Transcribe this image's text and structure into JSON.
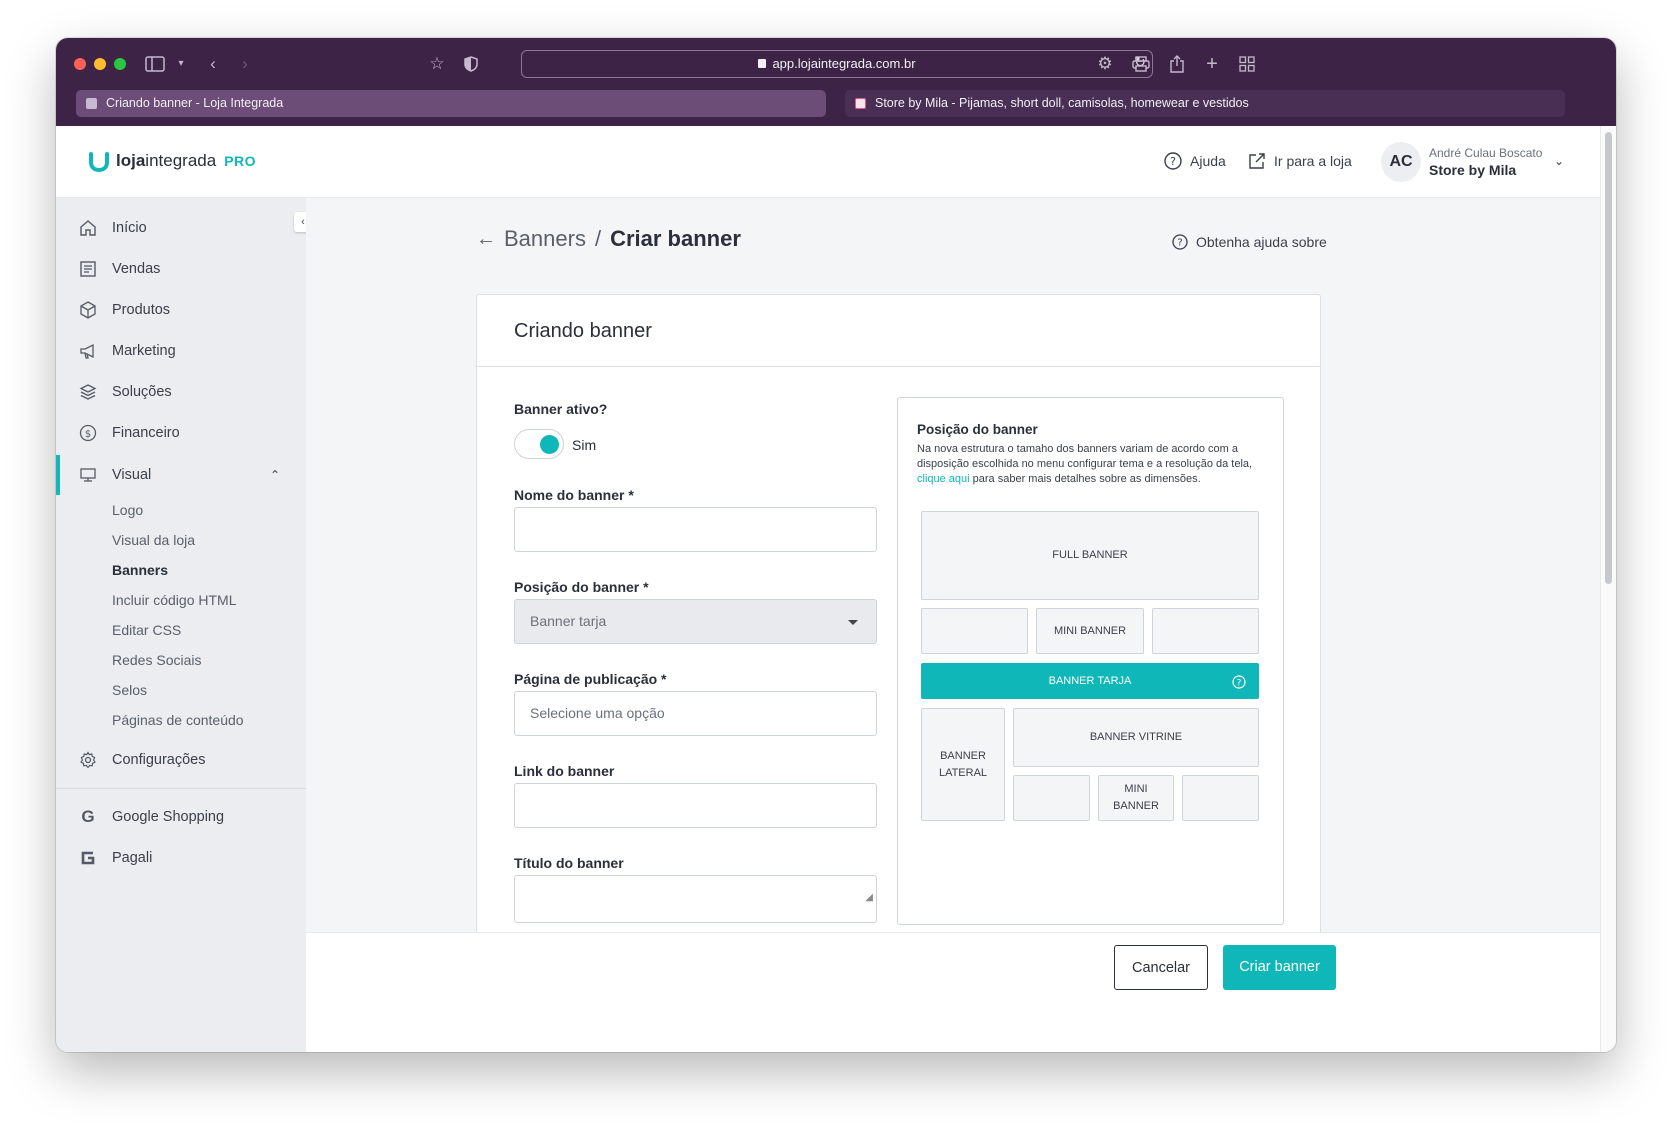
{
  "browser": {
    "url": "app.lojaintegrada.com.br",
    "tabs": [
      {
        "title": "Criando banner - Loja Integrada",
        "active": true
      },
      {
        "title": "Store by Mila - Pijamas, short doll, camisolas, homewear e vestidos",
        "active": false
      }
    ]
  },
  "header": {
    "logo_bold": "loja",
    "logo_light": "integrada",
    "logo_pro": "PRO",
    "help_label": "Ajuda",
    "store_link_label": "Ir para a loja",
    "avatar_initials": "AC",
    "user_name": "André Culau Boscato",
    "user_store": "Store by Mila"
  },
  "sidebar": {
    "items": [
      {
        "label": "Início",
        "icon": "home-icon"
      },
      {
        "label": "Vendas",
        "icon": "receipt-icon"
      },
      {
        "label": "Produtos",
        "icon": "box-icon"
      },
      {
        "label": "Marketing",
        "icon": "megaphone-icon"
      },
      {
        "label": "Soluções",
        "icon": "layers-icon"
      },
      {
        "label": "Financeiro",
        "icon": "dollar-icon"
      },
      {
        "label": "Visual",
        "icon": "monitor-icon",
        "active": true
      },
      {
        "label": "Configurações",
        "icon": "gear-icon"
      },
      {
        "label": "Google Shopping",
        "icon": "google-icon"
      },
      {
        "label": "Pagali",
        "icon": "pagali-icon"
      }
    ],
    "visual_subitems": [
      "Logo",
      "Visual da loja",
      "Banners",
      "Incluir código HTML",
      "Editar CSS",
      "Redes Sociais",
      "Selos",
      "Páginas de conteúdo"
    ],
    "active_subitem": "Banners"
  },
  "page": {
    "breadcrumb_parent": "Banners",
    "breadcrumb_sep": "/",
    "breadcrumb_current": "Criar banner",
    "help_about": "Obtenha ajuda sobre"
  },
  "form": {
    "card_title": "Criando banner",
    "active_label": "Banner ativo?",
    "active_value": "Sim",
    "name_label": "Nome do banner *",
    "name_value": "",
    "position_label": "Posição do banner *",
    "position_value": "Banner tarja",
    "page_label": "Página de publicação *",
    "page_placeholder": "Selecione uma opção",
    "link_label": "Link do banner",
    "link_value": "",
    "title_label": "Título do banner",
    "title_value": ""
  },
  "position_panel": {
    "title": "Posição do banner",
    "desc_before": "Na nova estrutura o tamaho dos banners variam de acordo com a disposição escolhida no menu configurar tema e a resolução da tela, ",
    "desc_link": "clique aqui",
    "desc_after": " para saber mais detalhes sobre as dimensões.",
    "full_banner": "FULL BANNER",
    "mini_banner": "MINI BANNER",
    "banner_tarja": "BANNER TARJA",
    "banner_lateral_1": "BANNER",
    "banner_lateral_2": "LATERAL",
    "banner_vitrine": "BANNER VITRINE",
    "mini_banner_1": "MINI",
    "mini_banner_2": "BANNER"
  },
  "footer": {
    "cancel_label": "Cancelar",
    "create_label": "Criar banner"
  },
  "colors": {
    "accent": "#0fb7b9",
    "titlebar": "#3d2447"
  }
}
